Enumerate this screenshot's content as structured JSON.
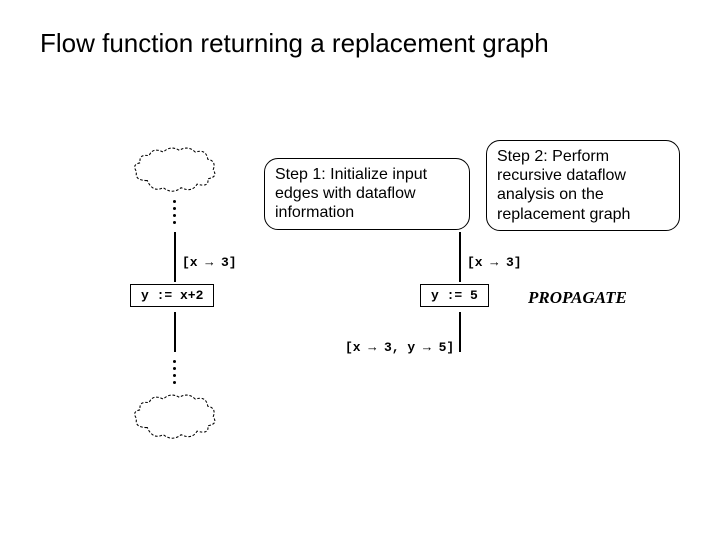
{
  "title": "Flow function returning a replacement graph",
  "step1": "Step 1: Initialize input edges with dataflow information",
  "step2": "Step 2: Perform recursive dataflow analysis on the replacement graph",
  "left": {
    "in_label": "[x → 3]",
    "node": "y := x+2"
  },
  "right": {
    "in_label": "[x → 3]",
    "node": "y := 5",
    "out_label": "[x → 3, y → 5]"
  },
  "propagate": "PROPAGATE"
}
